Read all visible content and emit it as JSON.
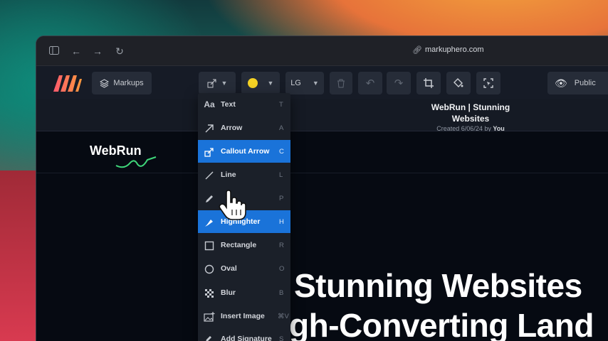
{
  "browser": {
    "url": "markuphero.com",
    "icons": [
      "sidebar-toggle-icon",
      "back-arrow-icon",
      "forward-arrow-icon",
      "reload-icon",
      "link-icon"
    ]
  },
  "toolbar": {
    "markups_label": "Markups",
    "color_value": "#f5d224",
    "size_label": "LG",
    "visibility_label": "Public"
  },
  "document": {
    "title": "WebRun | Stunning Websites",
    "created_prefix": "Created 6/06/24 by",
    "created_by": "You"
  },
  "canvas": {
    "site_logo": "WebRun",
    "hero_line1": "Stunning Websites",
    "hero_line2": "gh-Converting Land"
  },
  "tool_menu": {
    "items": [
      {
        "label": "Text",
        "shortcut": "T",
        "icon": "text-aa-icon",
        "active": false
      },
      {
        "label": "Arrow",
        "shortcut": "A",
        "icon": "arrow-icon",
        "active": false
      },
      {
        "label": "Callout Arrow",
        "shortcut": "C",
        "icon": "callout-arrow-icon",
        "active": true
      },
      {
        "label": "Line",
        "shortcut": "L",
        "icon": "line-icon",
        "active": false
      },
      {
        "label": "",
        "shortcut": "P",
        "icon": "pen-icon",
        "active": false
      },
      {
        "label": "Highlighter",
        "shortcut": "H",
        "icon": "highlighter-icon",
        "active": true
      },
      {
        "label": "Rectangle",
        "shortcut": "R",
        "icon": "rectangle-icon",
        "active": false
      },
      {
        "label": "Oval",
        "shortcut": "O",
        "icon": "oval-icon",
        "active": false
      },
      {
        "label": "Blur",
        "shortcut": "B",
        "icon": "blur-icon",
        "active": false
      },
      {
        "label": "Insert Image",
        "shortcut": "⌘V",
        "icon": "insert-image-icon",
        "active": false
      },
      {
        "label": "Add Signature",
        "shortcut": "S",
        "icon": "signature-icon",
        "active": false
      }
    ]
  },
  "colors": {
    "accent": "#1a73d9",
    "logo_gradient": [
      "#ff5a6e",
      "#ff9a3c"
    ]
  }
}
